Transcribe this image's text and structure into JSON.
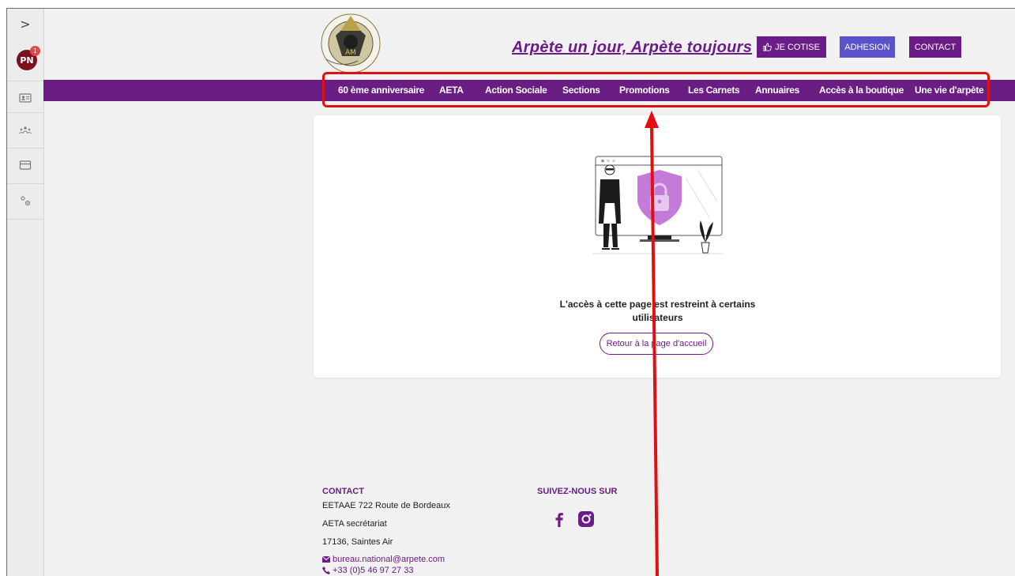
{
  "rail": {
    "toggle_glyph": ">",
    "avatar_initials": "PN",
    "avatar_badge": "1",
    "icons": [
      "id-card-icon",
      "group-icon",
      "card-icon",
      "settings-icon"
    ]
  },
  "header": {
    "tagline": "Arpète un jour, Arpète toujours",
    "cotise_label": "JE COTISE",
    "adhesion_label": "ADHESION",
    "contact_label": "CONTACT"
  },
  "nav": {
    "items": [
      "60 ème anniversaire",
      "AETA",
      "Action Sociale",
      "Sections",
      "Promotions",
      "Les Carnets",
      "Annuaires",
      "Accès à la boutique",
      "Une vie d'arpète"
    ]
  },
  "main": {
    "restricted_line1": "L'accès à cette page est restreint à certains",
    "restricted_line2": "utilisateurs",
    "home_button": "Retour à la page d'accueil"
  },
  "footer": {
    "contact_title": "CONTACT",
    "address1": "EETAAE 722 Route de Bordeaux",
    "address2": "AETA secrétariat",
    "address3": "17136, Saintes Air",
    "email": "bureau.national@arpete.com",
    "phone": "+33 (0)5 46 97 27 33",
    "follow_title": "SUIVEZ-NOUS SUR"
  },
  "colors": {
    "brand_purple": "#6b1c86",
    "adhesion_blue": "#5a52c8",
    "annotation_red": "#e01010"
  }
}
